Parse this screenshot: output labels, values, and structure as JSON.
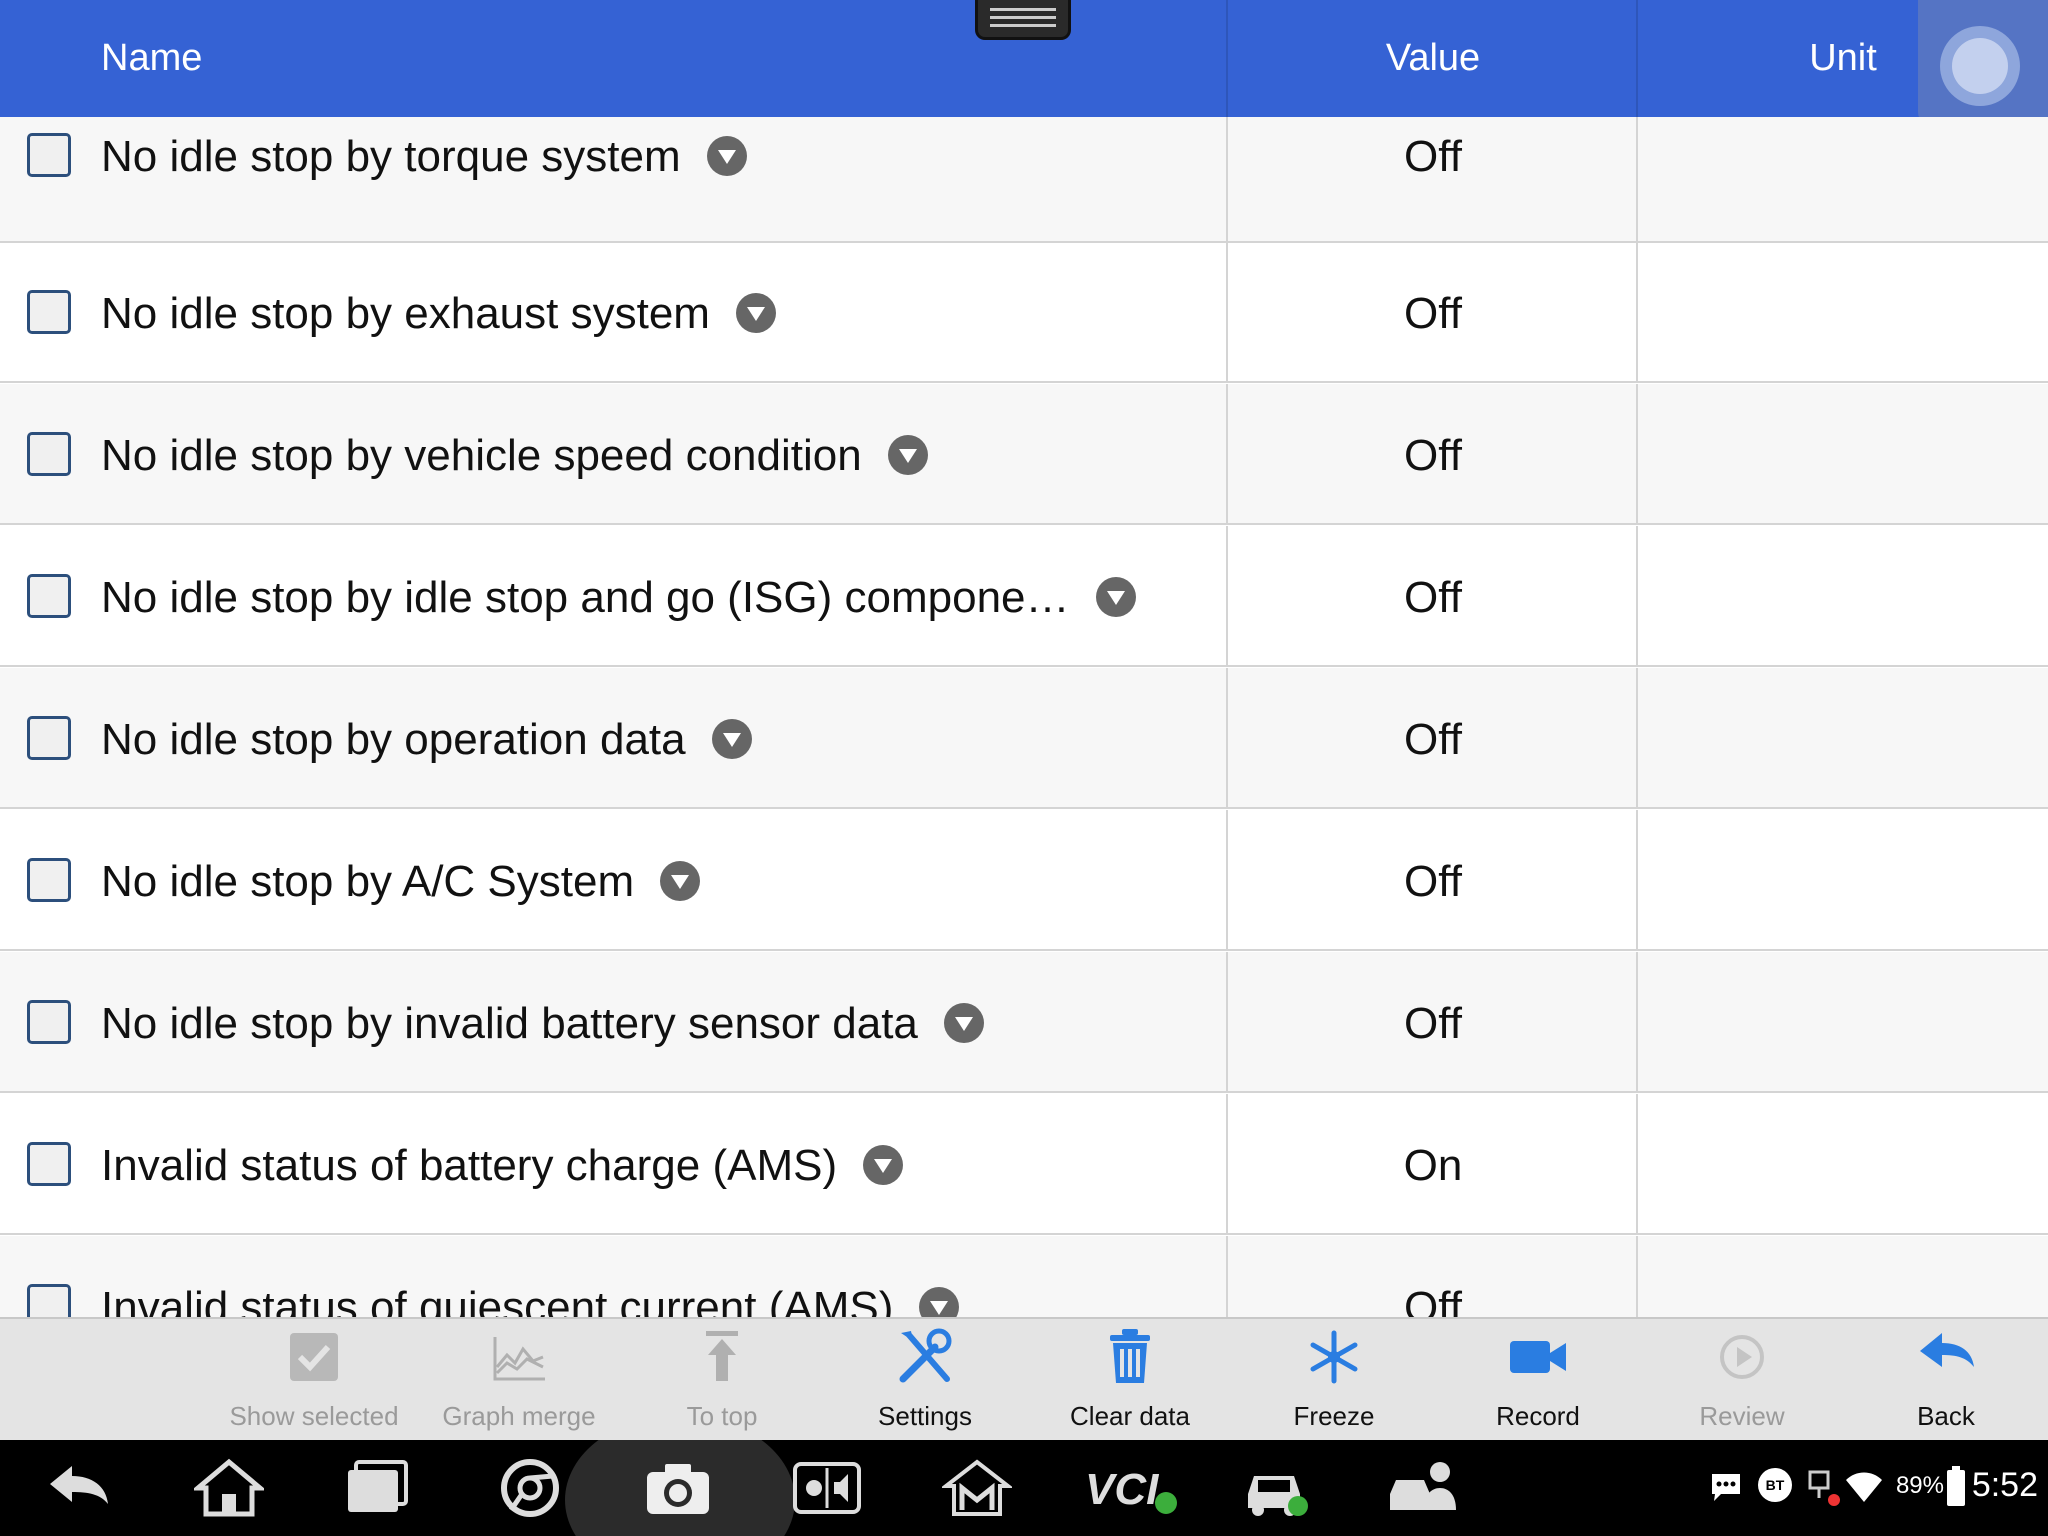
{
  "header": {
    "name": "Name",
    "value": "Value",
    "unit": "Unit"
  },
  "rows": [
    {
      "name": "No idle stop by torque system",
      "value": "Off",
      "unit": ""
    },
    {
      "name": "No idle stop by exhaust system",
      "value": "Off",
      "unit": ""
    },
    {
      "name": "No idle stop by vehicle speed condition",
      "value": "Off",
      "unit": ""
    },
    {
      "name": "No idle stop by idle stop and go (ISG) compone…",
      "value": "Off",
      "unit": ""
    },
    {
      "name": "No idle stop by operation data",
      "value": "Off",
      "unit": ""
    },
    {
      "name": "No idle stop by A/C System",
      "value": "Off",
      "unit": ""
    },
    {
      "name": "No idle stop by invalid battery sensor data",
      "value": "Off",
      "unit": ""
    },
    {
      "name": "Invalid status of battery charge (AMS)",
      "value": "On",
      "unit": ""
    },
    {
      "name": "Invalid status of quiescent current (AMS)",
      "value": "Off",
      "unit": ""
    }
  ],
  "toolbar": {
    "show_selected": "Show selected",
    "graph_merge": "Graph merge",
    "to_top": "To top",
    "settings": "Settings",
    "clear_data": "Clear data",
    "freeze": "Freeze",
    "record": "Record",
    "review": "Review",
    "back": "Back"
  },
  "statusbar": {
    "battery": "89%",
    "time": "5:52",
    "bt": "BT",
    "vci": "VCI"
  },
  "colors": {
    "header_bg": "#3562d4",
    "accent": "#2a7de1",
    "nav_bg": "#000000",
    "toolbar_bg": "#e4e4e4"
  }
}
